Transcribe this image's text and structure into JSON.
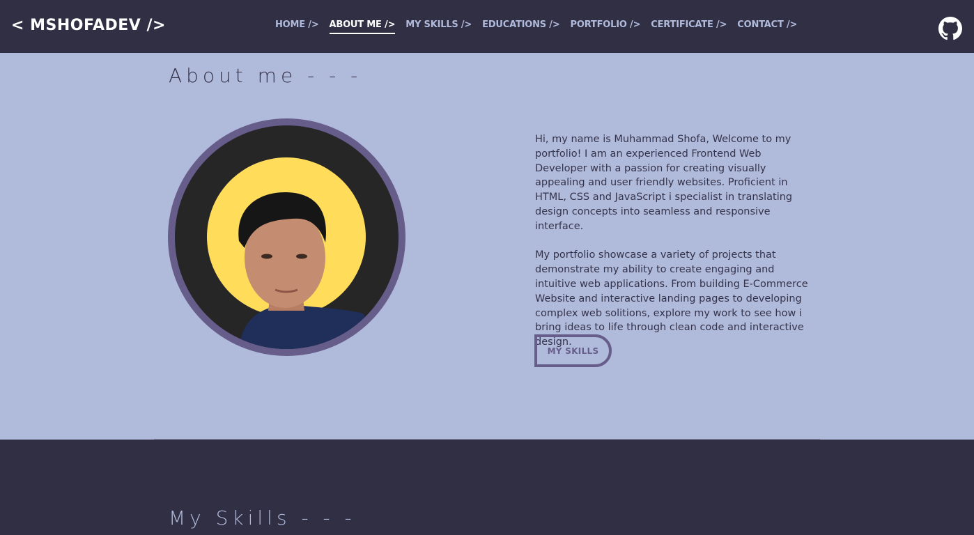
{
  "header": {
    "logo": "< MSHOFADEV />",
    "nav": [
      {
        "label": "HOME />",
        "active": false
      },
      {
        "label": "ABOUT ME />",
        "active": true
      },
      {
        "label": "MY SKILLS />",
        "active": false
      },
      {
        "label": "EDUCATIONS />",
        "active": false
      },
      {
        "label": "PORTFOLIO />",
        "active": false
      },
      {
        "label": "CERTIFICATE />",
        "active": false
      },
      {
        "label": "CONTACT />",
        "active": false
      }
    ],
    "github_icon": "github-icon"
  },
  "about": {
    "title": "About me - - -",
    "paragraph_1": "Hi, my name is Muhammad Shofa, Welcome to my portfolio! I am an experienced Frontend Web Developer with a passion for creating visually appealing and user friendly websites. Proficient in HTML, CSS and JavaScript i specialist in translating design concepts into seamless and responsive interface.",
    "paragraph_2": "My portfolio showcase a variety of projects that demonstrate my ability to create engaging and intuitive web applications. From building E-Commerce Website and interactive landing pages to developing complex web solitions, explore my work to see how i bring ideas to life through clean code and interactive design.",
    "button_label": "MY SKILLS"
  },
  "skills": {
    "title": "My Skills - - -"
  },
  "colors": {
    "nav_bg": "#312f44",
    "page_bg": "#b0badb",
    "accent": "#675d8b",
    "photo_bg": "#262626",
    "sun": "#ffdc5a"
  }
}
